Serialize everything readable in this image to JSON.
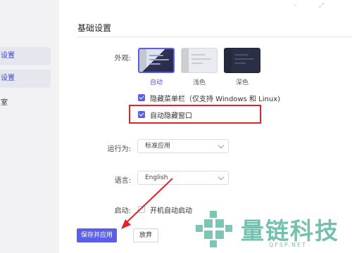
{
  "window_controls": {
    "minimize": "–",
    "maximize": "⤢"
  },
  "sidebar": {
    "items": [
      {
        "label": "设置"
      },
      {
        "label": "设置"
      },
      {
        "label": "室"
      }
    ]
  },
  "section": {
    "title": "基础设置"
  },
  "appearance": {
    "label": "外观:",
    "themes": [
      {
        "name": "自动",
        "selected": true
      },
      {
        "name": "浅色",
        "selected": false
      },
      {
        "name": "深色",
        "selected": false
      }
    ]
  },
  "options": {
    "hide_menubar": {
      "label": "隐藏菜单栏（仅支持 Windows 和 Linux)",
      "checked": true
    },
    "auto_hide_window": {
      "label": "自动隐藏窗口",
      "checked": true
    },
    "autostart": {
      "label": "开机自动启动",
      "checked": false
    }
  },
  "run_as": {
    "label": "运行为:",
    "value": "标准应用"
  },
  "language": {
    "label": "语言:",
    "value": "English"
  },
  "startup": {
    "label": "启动:"
  },
  "buttons": {
    "save": "保存并应用",
    "discard": "放弃"
  },
  "colors": {
    "accent": "#5b5ee6",
    "highlight_box": "#e0222a",
    "watermark": "#008c6e"
  },
  "watermark": {
    "brand": "量链科技",
    "url": "QFSP.NET"
  }
}
